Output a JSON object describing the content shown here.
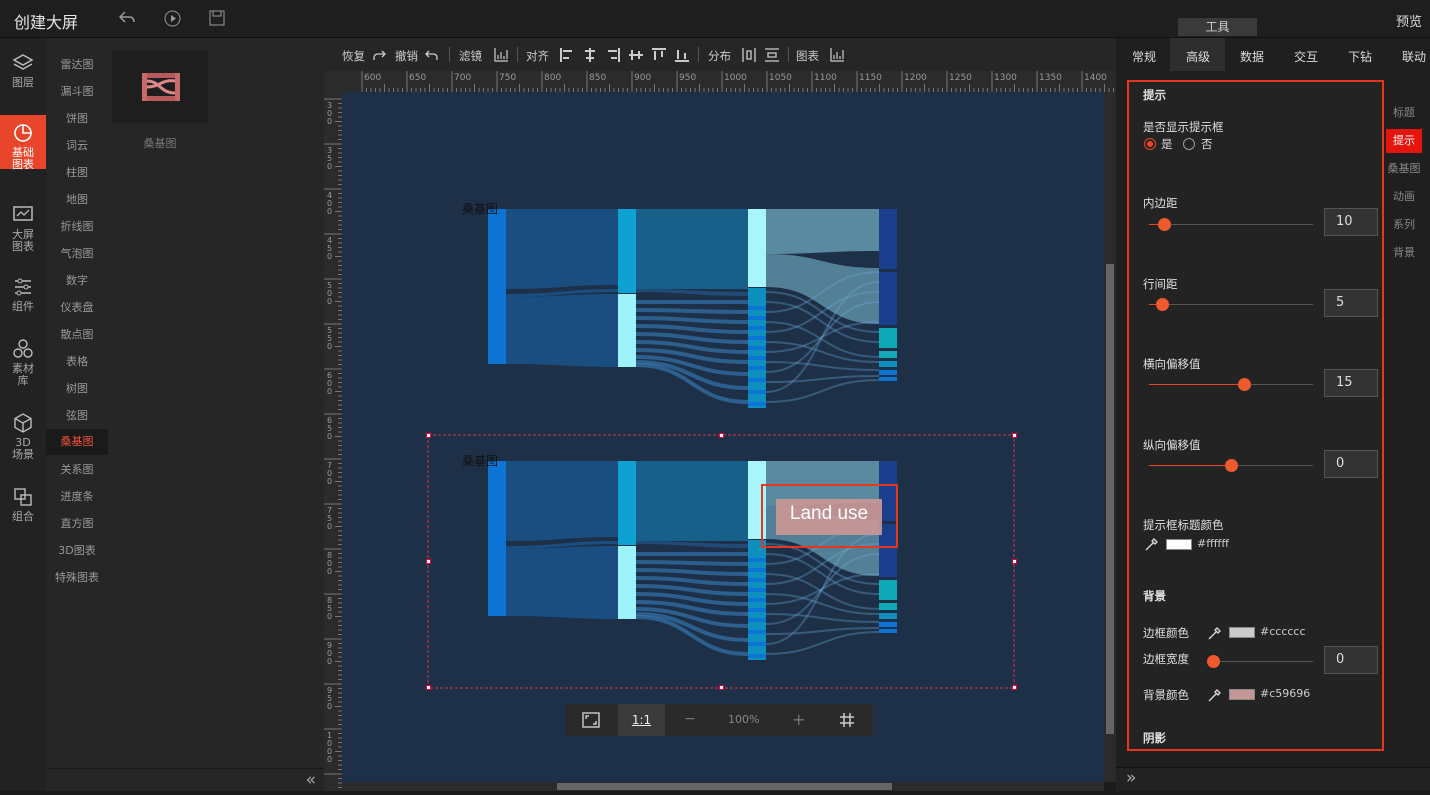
{
  "app": {
    "title": "创建大屏",
    "preview": "预览",
    "tools_tab": "工具"
  },
  "left_nav": [
    {
      "label": "图层",
      "icon": "layers-icon"
    },
    {
      "label": "基础图表",
      "icon": "pie-chart-icon",
      "active": true
    },
    {
      "label": "大屏图表",
      "icon": "screen-chart-icon"
    },
    {
      "label": "组件",
      "icon": "sliders-icon"
    },
    {
      "label": "素材库",
      "icon": "hexagons-icon"
    },
    {
      "label": "3D场景",
      "icon": "cube-icon"
    },
    {
      "label": "组合",
      "icon": "combine-icon"
    }
  ],
  "categories": [
    "雷达图",
    "漏斗图",
    "饼图",
    "词云",
    "柱图",
    "地图",
    "折线图",
    "气泡图",
    "数字",
    "仪表盘",
    "散点图",
    "表格",
    "树图",
    "弦图",
    "桑基图",
    "关系图",
    "进度条",
    "直方图",
    "3D图表",
    "特殊图表"
  ],
  "active_category": "桑基图",
  "thumb_label": "桑基图",
  "toolbar": {
    "restore": "恢复",
    "undo": "撤销",
    "filter": "滤镜",
    "align": "对齐",
    "distribute": "分布",
    "chart": "图表"
  },
  "ruler_labels": [
    "600",
    "650",
    "700",
    "750",
    "800",
    "850",
    "900",
    "950",
    "1000",
    "1050",
    "1100",
    "1150",
    "1200",
    "1250",
    "1300",
    "1350",
    "1400"
  ],
  "vruler_labels": [
    "300",
    "350",
    "400",
    "450",
    "500",
    "550",
    "600",
    "650",
    "700",
    "750",
    "800",
    "850",
    "900",
    "950",
    "1000"
  ],
  "charts": [
    {
      "title": "桑基图"
    },
    {
      "title": "桑基图",
      "tooltip": "Land use",
      "selected": true
    }
  ],
  "zoom": {
    "ratio": "1:1",
    "value": "100%",
    "minus": "−",
    "plus": "+"
  },
  "right_tabs": [
    "常规",
    "高级",
    "数据",
    "交互",
    "下钻",
    "联动"
  ],
  "active_right_tab": "高级",
  "side_tabs": [
    "标题",
    "提示",
    "桑基图",
    "动画",
    "系列",
    "背景"
  ],
  "active_side_tab": "提示",
  "form": {
    "section": "提示",
    "show_label": "是否显示提示框",
    "yes": "是",
    "no": "否",
    "show_selected": "是",
    "padding_label": "内边距",
    "padding_value": "10",
    "padding_level": 0.09,
    "linegap_label": "行间距",
    "linegap_value": "5",
    "linegap_level": 0.08,
    "xoffset_label": "横向偏移值",
    "xoffset_value": "15",
    "xoffset_level": 0.58,
    "yoffset_label": "纵向偏移值",
    "yoffset_value": "0",
    "yoffset_level": 0.5,
    "title_color_label": "提示框标题颜色",
    "title_color": "#ffffff",
    "bg_section": "背景",
    "border_color_label": "边框颜色",
    "border_color": "#cccccc",
    "border_width_label": "边框宽度",
    "border_width_value": "0",
    "border_width_level": 0,
    "bg_color_label": "背景颜色",
    "bg_color": "#c59696",
    "shadow_section": "阴影"
  }
}
